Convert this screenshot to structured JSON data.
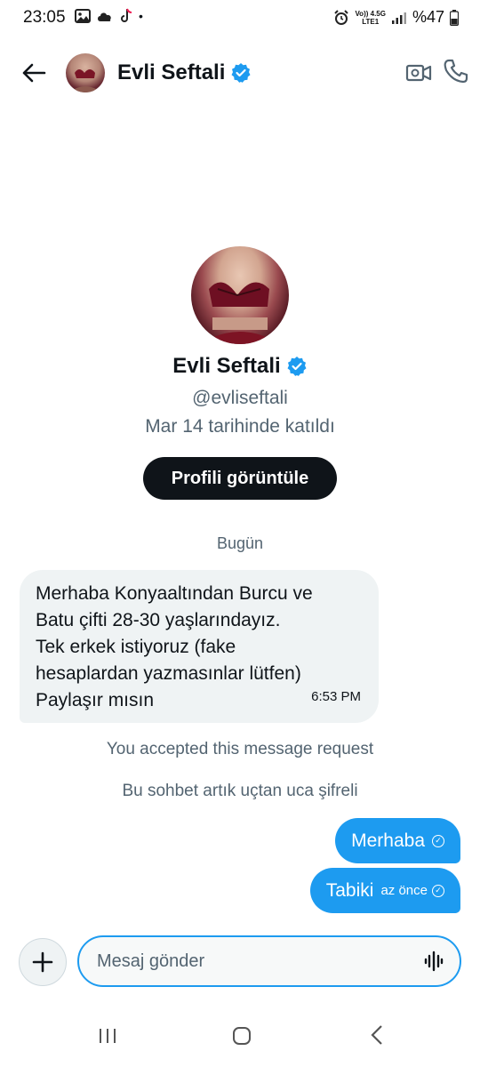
{
  "status_bar": {
    "time": "23:05",
    "network_top": "Vo)) 4.5G",
    "network_bottom": "LTE1",
    "battery": "%47"
  },
  "header": {
    "contact_name": "Evli Seftali",
    "verified_icon": "verified-badge-icon",
    "icons": [
      "back-arrow-icon",
      "video-call-icon",
      "phone-call-icon"
    ]
  },
  "profile": {
    "name": "Evli Seftali",
    "handle": "@evliseftali",
    "joined": "Mar 14 tarihinde katıldı",
    "view_button": "Profili görüntüle"
  },
  "conversation": {
    "day_label": "Bugün",
    "incoming": {
      "lines": [
        "Merhaba Konyaaltından Burcu ve",
        "Batu çifti 28-30 yaşlarındayız.",
        "Tek erkek istiyoruz (fake",
        "hesaplardan yazmasınlar lütfen)",
        "Paylaşır mısın"
      ],
      "time": "6:53 PM"
    },
    "system_1": "You accepted this message request",
    "system_2": "Bu sohbet artık uçtan uca şifreli",
    "outgoing": [
      {
        "text": "Merhaba",
        "meta": ""
      },
      {
        "text": "Tabiki",
        "meta": "az önce"
      }
    ]
  },
  "composer": {
    "placeholder": "Mesaj gönder"
  },
  "colors": {
    "accent": "#1d9bf0",
    "text": "#0f1419",
    "secondary": "#536471",
    "bubble_in": "#eff3f4"
  }
}
